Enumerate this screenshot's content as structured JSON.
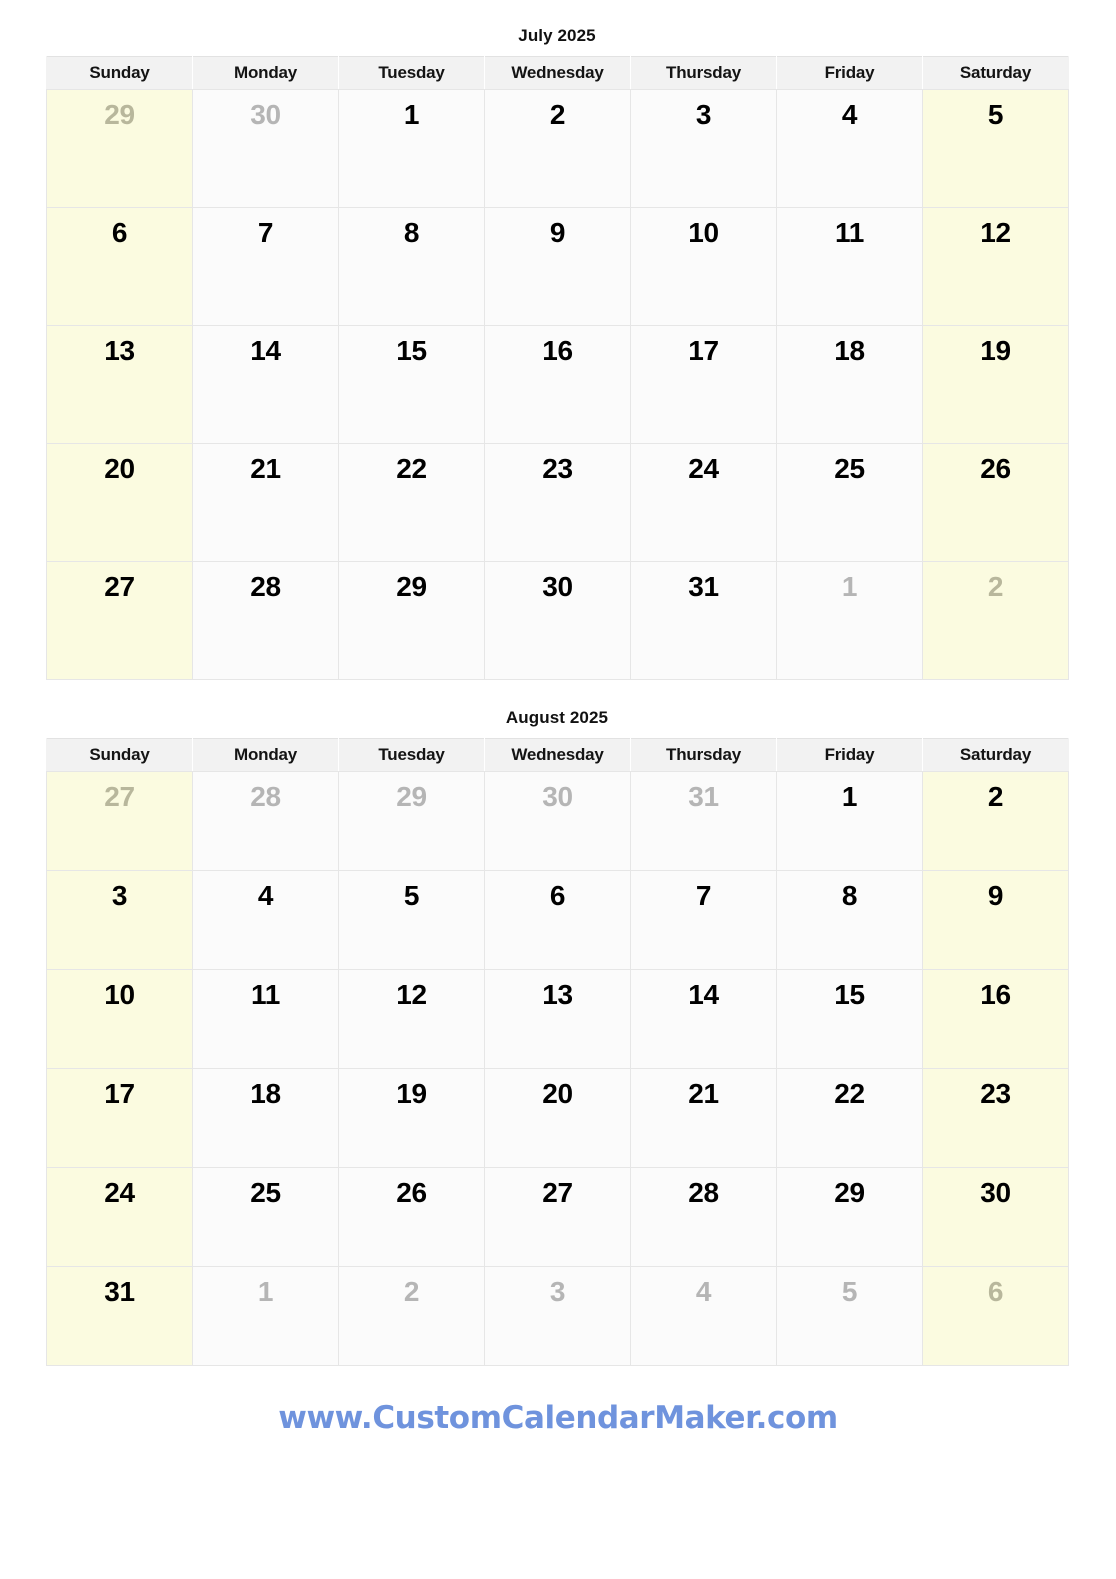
{
  "page": {
    "background_color": "#ffffff",
    "weekend_cell_color": "#fbfbe0",
    "weekday_cell_color": "#fbfbfb",
    "header_row_color": "#f2f2f2",
    "grid_line_color": "#e6e6e6",
    "in_month_text_color": "#000000",
    "out_of_month_text_color": "#b5b5b5",
    "footer_link_color": "#6f93dd"
  },
  "day_names": [
    "Sunday",
    "Monday",
    "Tuesday",
    "Wednesday",
    "Thursday",
    "Friday",
    "Saturday"
  ],
  "months": [
    {
      "id": "july",
      "title": "July 2025",
      "weeks": [
        [
          {
            "n": "29",
            "in_month": false,
            "weekend": true
          },
          {
            "n": "30",
            "in_month": false,
            "weekend": false
          },
          {
            "n": "1",
            "in_month": true,
            "weekend": false
          },
          {
            "n": "2",
            "in_month": true,
            "weekend": false
          },
          {
            "n": "3",
            "in_month": true,
            "weekend": false
          },
          {
            "n": "4",
            "in_month": true,
            "weekend": false
          },
          {
            "n": "5",
            "in_month": true,
            "weekend": true
          }
        ],
        [
          {
            "n": "6",
            "in_month": true,
            "weekend": true
          },
          {
            "n": "7",
            "in_month": true,
            "weekend": false
          },
          {
            "n": "8",
            "in_month": true,
            "weekend": false
          },
          {
            "n": "9",
            "in_month": true,
            "weekend": false
          },
          {
            "n": "10",
            "in_month": true,
            "weekend": false
          },
          {
            "n": "11",
            "in_month": true,
            "weekend": false
          },
          {
            "n": "12",
            "in_month": true,
            "weekend": true
          }
        ],
        [
          {
            "n": "13",
            "in_month": true,
            "weekend": true
          },
          {
            "n": "14",
            "in_month": true,
            "weekend": false
          },
          {
            "n": "15",
            "in_month": true,
            "weekend": false
          },
          {
            "n": "16",
            "in_month": true,
            "weekend": false
          },
          {
            "n": "17",
            "in_month": true,
            "weekend": false
          },
          {
            "n": "18",
            "in_month": true,
            "weekend": false
          },
          {
            "n": "19",
            "in_month": true,
            "weekend": true
          }
        ],
        [
          {
            "n": "20",
            "in_month": true,
            "weekend": true
          },
          {
            "n": "21",
            "in_month": true,
            "weekend": false
          },
          {
            "n": "22",
            "in_month": true,
            "weekend": false
          },
          {
            "n": "23",
            "in_month": true,
            "weekend": false
          },
          {
            "n": "24",
            "in_month": true,
            "weekend": false
          },
          {
            "n": "25",
            "in_month": true,
            "weekend": false
          },
          {
            "n": "26",
            "in_month": true,
            "weekend": true
          }
        ],
        [
          {
            "n": "27",
            "in_month": true,
            "weekend": true
          },
          {
            "n": "28",
            "in_month": true,
            "weekend": false
          },
          {
            "n": "29",
            "in_month": true,
            "weekend": false
          },
          {
            "n": "30",
            "in_month": true,
            "weekend": false
          },
          {
            "n": "31",
            "in_month": true,
            "weekend": false
          },
          {
            "n": "1",
            "in_month": false,
            "weekend": false
          },
          {
            "n": "2",
            "in_month": false,
            "weekend": true
          }
        ]
      ]
    },
    {
      "id": "august",
      "title": "August 2025",
      "weeks": [
        [
          {
            "n": "27",
            "in_month": false,
            "weekend": true
          },
          {
            "n": "28",
            "in_month": false,
            "weekend": false
          },
          {
            "n": "29",
            "in_month": false,
            "weekend": false
          },
          {
            "n": "30",
            "in_month": false,
            "weekend": false
          },
          {
            "n": "31",
            "in_month": false,
            "weekend": false
          },
          {
            "n": "1",
            "in_month": true,
            "weekend": false
          },
          {
            "n": "2",
            "in_month": true,
            "weekend": true
          }
        ],
        [
          {
            "n": "3",
            "in_month": true,
            "weekend": true
          },
          {
            "n": "4",
            "in_month": true,
            "weekend": false
          },
          {
            "n": "5",
            "in_month": true,
            "weekend": false
          },
          {
            "n": "6",
            "in_month": true,
            "weekend": false
          },
          {
            "n": "7",
            "in_month": true,
            "weekend": false
          },
          {
            "n": "8",
            "in_month": true,
            "weekend": false
          },
          {
            "n": "9",
            "in_month": true,
            "weekend": true
          }
        ],
        [
          {
            "n": "10",
            "in_month": true,
            "weekend": true
          },
          {
            "n": "11",
            "in_month": true,
            "weekend": false
          },
          {
            "n": "12",
            "in_month": true,
            "weekend": false
          },
          {
            "n": "13",
            "in_month": true,
            "weekend": false
          },
          {
            "n": "14",
            "in_month": true,
            "weekend": false
          },
          {
            "n": "15",
            "in_month": true,
            "weekend": false
          },
          {
            "n": "16",
            "in_month": true,
            "weekend": true
          }
        ],
        [
          {
            "n": "17",
            "in_month": true,
            "weekend": true
          },
          {
            "n": "18",
            "in_month": true,
            "weekend": false
          },
          {
            "n": "19",
            "in_month": true,
            "weekend": false
          },
          {
            "n": "20",
            "in_month": true,
            "weekend": false
          },
          {
            "n": "21",
            "in_month": true,
            "weekend": false
          },
          {
            "n": "22",
            "in_month": true,
            "weekend": false
          },
          {
            "n": "23",
            "in_month": true,
            "weekend": true
          }
        ],
        [
          {
            "n": "24",
            "in_month": true,
            "weekend": true
          },
          {
            "n": "25",
            "in_month": true,
            "weekend": false
          },
          {
            "n": "26",
            "in_month": true,
            "weekend": false
          },
          {
            "n": "27",
            "in_month": true,
            "weekend": false
          },
          {
            "n": "28",
            "in_month": true,
            "weekend": false
          },
          {
            "n": "29",
            "in_month": true,
            "weekend": false
          },
          {
            "n": "30",
            "in_month": true,
            "weekend": true
          }
        ],
        [
          {
            "n": "31",
            "in_month": true,
            "weekend": true
          },
          {
            "n": "1",
            "in_month": false,
            "weekend": false
          },
          {
            "n": "2",
            "in_month": false,
            "weekend": false
          },
          {
            "n": "3",
            "in_month": false,
            "weekend": false
          },
          {
            "n": "4",
            "in_month": false,
            "weekend": false
          },
          {
            "n": "5",
            "in_month": false,
            "weekend": false
          },
          {
            "n": "6",
            "in_month": false,
            "weekend": true
          }
        ]
      ]
    }
  ],
  "footer": {
    "url_text": "www.CustomCalendarMaker.com"
  }
}
